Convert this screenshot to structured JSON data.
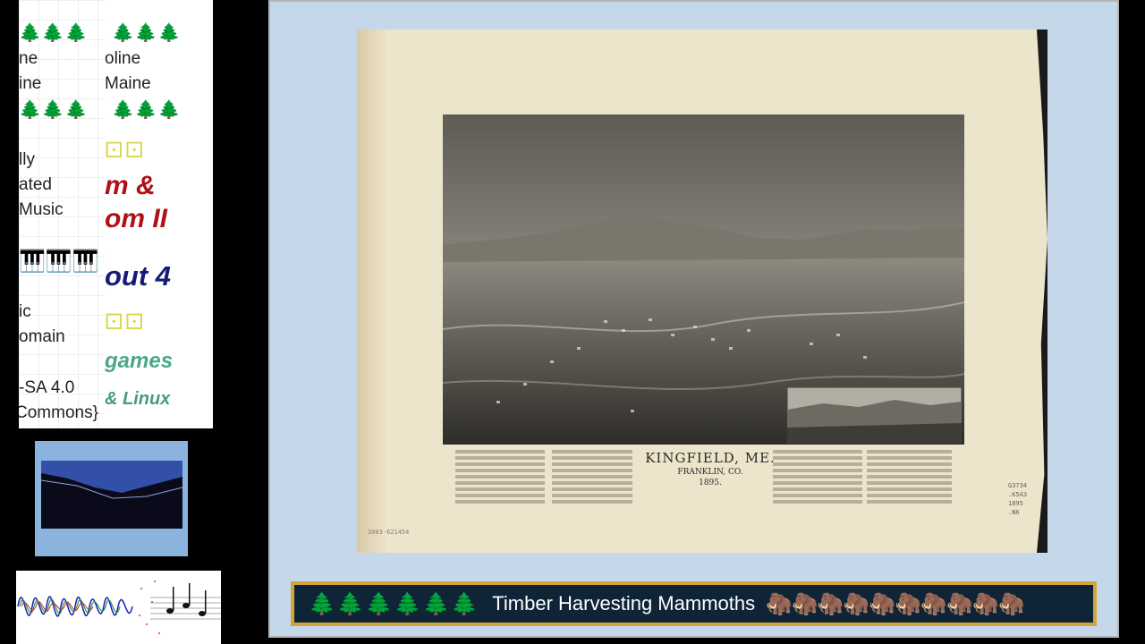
{
  "info_card": {
    "column_a": {
      "trees_top": "🌲🌲🌲",
      "line1": "ne",
      "line2": "ine",
      "trees_mid": "🌲🌲🌲",
      "credit1": "lly",
      "credit2": "ated",
      "credit3": " Music",
      "piano": "🎹🎹🎹",
      "license1": "ic",
      "license2": "omain",
      "license3": "-SA 4.0",
      "license4": "Commons}"
    },
    "column_b": {
      "trees_top": "🌲🌲🌲",
      "line1": "oline",
      "line2": "Maine",
      "trees_mid": "🌲🌲🌲",
      "dice1": "⚀⚀",
      "game1a": "m &",
      "game1b": "om II",
      "game2": "out 4",
      "dice2": "⚀⚀",
      "game3": "games",
      "game4": "& Linux"
    }
  },
  "thumbnail": {
    "icon": "landscape-thumbnail"
  },
  "waveform": {
    "icon": "waveform-music-notes"
  },
  "map": {
    "title": "KINGFIELD, ME.",
    "county": "FRANKLIN, CO.",
    "year": "1895.",
    "catalog_note": "3003-621454",
    "call_number": [
      "G3734",
      ".K5A3",
      "1895",
      ".N6"
    ]
  },
  "banner": {
    "trees": "🌲🌲🌲🌲🌲🌲",
    "title": "Timber Harvesting Mammoths",
    "mammoths": "🦣🦣🦣🦣🦣🦣🦣🦣🦣🦣"
  },
  "colors": {
    "banner_border": "#d4a43a",
    "banner_bg": "#0f2537",
    "panel_bg": "#c5d8ea"
  }
}
